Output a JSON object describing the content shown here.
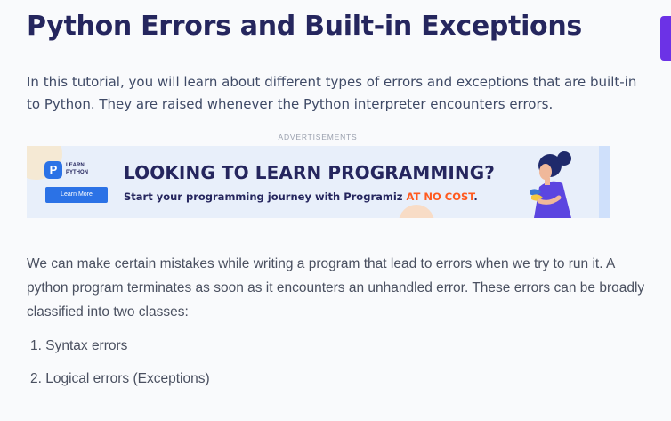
{
  "article": {
    "title": "Python Errors and Built-in Exceptions",
    "intro": "In this tutorial, you will learn about different types of errors and exceptions that are built-in to Python. They are raised whenever the Python interpreter encounters errors.",
    "body": "We can make certain mistakes while writing a program that lead to errors when we try to run it. A python program terminates as soon as it encounters an unhandled error. These errors can be broadly classified into two classes:",
    "list": [
      {
        "marker": "1.",
        "text": "Syntax errors"
      },
      {
        "marker": "2.",
        "text": "Logical errors (Exceptions)"
      }
    ]
  },
  "ad": {
    "label": "ADVERTISEMENTS",
    "logo_mark": "P",
    "logo_line1": "LEARN",
    "logo_line2": "PYTHON",
    "button": "Learn More",
    "headline": "LOOKING TO LEARN PROGRAMMING?",
    "sub_main": "Start your programming journey with Programiz ",
    "sub_accent": "AT NO COST",
    "sub_end": "."
  },
  "colors": {
    "title": "#25265e",
    "text": "#4a5060",
    "accent": "#ff5a1f",
    "brand_blue": "#2b72e6",
    "purple_tab": "#6c32e6"
  }
}
